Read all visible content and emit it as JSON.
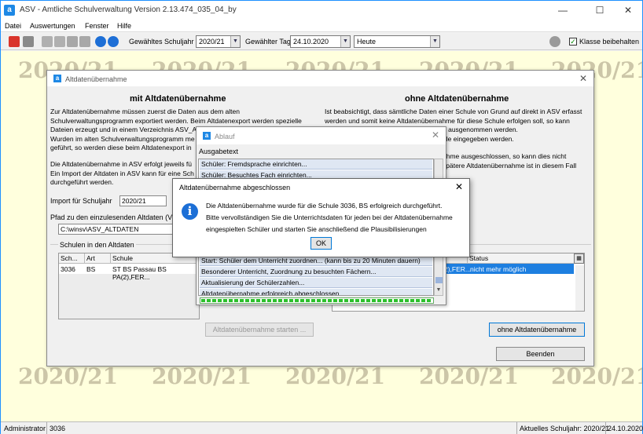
{
  "app": {
    "title": "ASV - Amtliche Schulverwaltung Version 2.13.474_035_04_by",
    "controls": {
      "minimize": "—",
      "maximize": "☐",
      "close": "✕"
    }
  },
  "menu": [
    "Datei",
    "Auswertungen",
    "Fenster",
    "Hilfe"
  ],
  "toolbar": {
    "schuljahr_label": "Gewähltes Schuljahr",
    "schuljahr_value": "2020/21",
    "tag_label": "Gewählter Tag",
    "tag_value": "24.10.2020",
    "heute_value": "Heute",
    "klasse_label": "Klasse beibehalten",
    "klasse_checked": "✓"
  },
  "watermark": "2020/21",
  "status": {
    "user": "Administrator",
    "school": "3036",
    "schuljahr": "Aktuelles Schuljahr: 2020/21",
    "date": "24.10.2020"
  },
  "dialog": {
    "title": "Altdatenübernahme",
    "close": "✕",
    "left_heading": "mit Altdatenübernahme",
    "left_p1": [
      "Zur Altdatenübernahme müssen zuerst die Daten aus dem alten",
      "Schulverwaltungsprogramm exportiert werden. Beim Altdatenexport werden spezielle",
      "Dateien erzeugt und in einem Verzeichnis ASV_A",
      "Wurden im alten Schulverwaltungsprogramm me",
      "geführt, so werden diese beim Altdatenexport in"
    ],
    "left_p2": [
      "Die Altdatenübernahme in ASV erfolgt jeweils fü",
      "Ein Import der Altdaten in ASV kann für eine Sch",
      "durchgeführt werden."
    ],
    "import_label": "Import für Schuljahr",
    "import_value": "2020/21",
    "path_label": "Pfad zu den einzulesenden Altdaten (Ve",
    "path_value": "C:\\winsv\\ASV_ALTDATEN",
    "group_label": "Schulen in den Altdaten",
    "grid_headers": [
      "Sch...",
      "Art",
      "Schule"
    ],
    "grid_row": [
      "3036",
      "BS",
      "ST BS Passau BS PA(2),FER..."
    ],
    "right_heading": "ohne Altdatenübernahme",
    "right_p1": [
      "Ist beabsichtigt, dass sämtliche Daten einer Schule von Grund auf direkt in ASV erfasst",
      "werden und somit keine Altdatenübernahme für diese Schule erfolgen soll, so kann",
      "e ausgenommen werden.",
      "ule eingegeben werden."
    ],
    "right_p2": [
      "ahme ausgeschlossen, so kann dies nicht",
      "spätere Altdatenübernahme ist in diesem Fall"
    ],
    "right_grid_header": "Status",
    "right_grid_row_left": "2),FER...",
    "right_grid_row_status": "nicht mehr möglich",
    "start_button": "Altdatenübernahme starten ...",
    "ohne_button": "ohne Altdatenübernahme",
    "beenden_button": "Beenden"
  },
  "ablauf": {
    "title": "Ablauf",
    "close": "✕",
    "list_header": "Ausgabetext",
    "items_top": [
      "Schüler: Fremdsprache einrichten...",
      "Schüler: Besuchtes Fach einrichten..."
    ],
    "items_bottom": [
      "Start: Schüler dem Unterricht zuordnen... (kann bis zu 20 Minuten dauern)",
      "Besonderer Unterricht, Zuordnung zu besuchten Fächern...",
      "Aktualisierung der Schülerzahlen...",
      "Altdatenübernahme erfolgreich abgeschlossen"
    ],
    "progress_percent": 100
  },
  "message": {
    "title": "Altdatenübernahme abgeschlossen",
    "close": "✕",
    "icon": "i",
    "lines": [
      "Die Altdatenübernahme wurde für die Schule 3036, BS erfolgreich durchgeführt.",
      "Bitte vervollständigen Sie die Unterrichtsdaten für jeden bei der Altdatenübernahme",
      "eingespielten Schüler und starten Sie anschließend die Plausibilisierungen"
    ],
    "ok": "OK"
  }
}
